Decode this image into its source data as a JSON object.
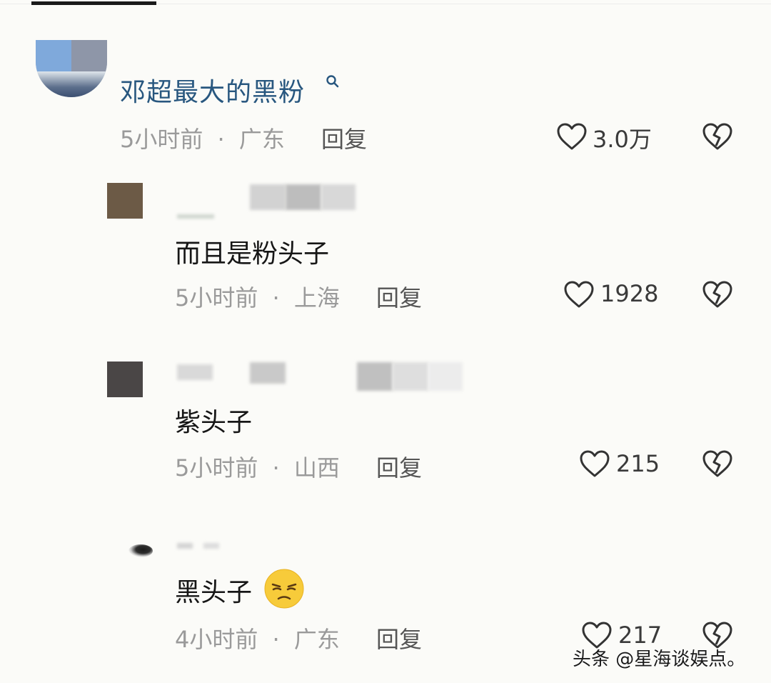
{
  "comment": {
    "username": "邓超最大的黑粉",
    "time": "5小时前",
    "location": "广东",
    "reply_label": "回复",
    "likes": "3.0万",
    "search_icon": "search-icon",
    "like_icon": "heart-icon",
    "dislike_icon": "broken-heart-icon"
  },
  "replies": [
    {
      "text": "而且是粉头子",
      "time": "5小时前",
      "location": "上海",
      "reply_label": "回复",
      "likes": "1928"
    },
    {
      "text": "紫头子",
      "time": "5小时前",
      "location": "山西",
      "reply_label": "回复",
      "likes": "215"
    },
    {
      "text": "黑头子",
      "emoji": "squinting-face-emoji",
      "time": "4小时前",
      "location": "广东",
      "reply_label": "回复",
      "likes": "217"
    }
  ],
  "separator": "·",
  "watermark": "头条 @星海谈娱点。",
  "colors": {
    "username": "#28577f",
    "meta": "#9a9a9a",
    "background": "#fbfbf8"
  }
}
